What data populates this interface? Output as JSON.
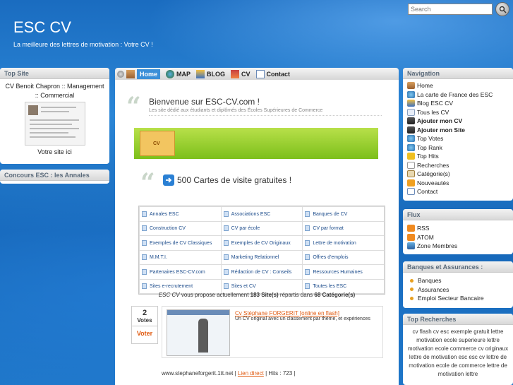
{
  "header": {
    "title": "ESC CV",
    "tagline": "La meilleure des lettres de motivation : Votre CV !",
    "search_placeholder": "Search"
  },
  "left": {
    "top_site": {
      "heading": "Top Site",
      "name": "CV Benoit Chapron :: Management :: Commercial",
      "footer": "Votre site ici"
    },
    "concours": {
      "heading": "Concours ESC : les Annales"
    }
  },
  "menu": {
    "items": [
      {
        "label": "Home",
        "icon": "home-icon"
      },
      {
        "label": "MAP",
        "icon": "globe-icon"
      },
      {
        "label": "BLOG",
        "icon": "blog-icon"
      },
      {
        "label": "CV",
        "icon": "cv-icon"
      },
      {
        "label": "Contact",
        "icon": "mail-icon"
      }
    ]
  },
  "main": {
    "welcome_title": "Bienvenue sur ESC-CV.com !",
    "welcome_sub": "Les site dédié aux étudiants et diplômés des Écoles Supérieures de Commerce",
    "banner_label": "CV",
    "cards_title": "500 Cartes de visite gratuites !",
    "grid": [
      [
        "Annales ESC",
        "Associations ESC",
        "Banques de CV"
      ],
      [
        "Construction CV",
        "CV par école",
        "CV par format"
      ],
      [
        "Exemples de CV Classiques",
        "Exemples de CV Originaux",
        "Lettre de motivation"
      ],
      [
        "M.M.T.I.",
        "Marketing Relationnel",
        "Offres d'emplois"
      ],
      [
        "Partenaires ESC-CV.com",
        "Rédaction de CV : Conseils",
        "Ressources Humaines"
      ],
      [
        "Sites e-recrutement",
        "Sites et CV",
        "Toutes les ESC"
      ]
    ],
    "stats": {
      "brand": "ESC CV",
      "text1": " vous propose actuellement ",
      "sites": "183 Site(s)",
      "text2": " répartis dans ",
      "cats": "68 Catégorie(s)"
    },
    "vote": {
      "count": "2",
      "label": "Votes",
      "button": "Voter"
    },
    "site": {
      "link": "Cv Stéphane FORGERIT [online en flash]",
      "desc": "Un CV original avec un classement par thème, et expériences",
      "url": "www.stephaneforgerit.1tt.net",
      "direct": "Lien direct",
      "hits": "| Hits : 723 |"
    }
  },
  "right": {
    "navigation": {
      "heading": "Navigation",
      "items": [
        {
          "label": "Home",
          "icon": "home-icon",
          "bold": false
        },
        {
          "label": "La carte de France des ESC",
          "icon": "globe-icon",
          "bold": false
        },
        {
          "label": "Blog ESC CV",
          "icon": "blog-icon",
          "bold": false
        },
        {
          "label": "Tous les CV",
          "icon": "list-icon",
          "bold": false
        },
        {
          "label": "Ajouter mon CV",
          "icon": "user-add-icon",
          "bold": true
        },
        {
          "label": "Ajouter mon Site",
          "icon": "user-add-icon",
          "bold": true
        },
        {
          "label": "Top Votes",
          "icon": "globe-icon",
          "bold": false
        },
        {
          "label": "Top Rank",
          "icon": "globe-icon",
          "bold": false
        },
        {
          "label": "Top Hits",
          "icon": "star-icon",
          "bold": false
        },
        {
          "label": "Recherches",
          "icon": "search-icon",
          "bold": false
        },
        {
          "label": "Catégorie(s)",
          "icon": "tree-icon",
          "bold": false
        },
        {
          "label": "Nouveautés",
          "icon": "new-icon",
          "bold": false
        },
        {
          "label": "Contact",
          "icon": "mail-icon",
          "bold": false
        }
      ]
    },
    "flux": {
      "heading": "Flux",
      "items": [
        {
          "label": "RSS",
          "icon": "rss-icon"
        },
        {
          "label": "ATOM",
          "icon": "rss-icon"
        },
        {
          "label": "Zone Membres",
          "icon": "members-icon"
        }
      ]
    },
    "banques": {
      "heading": "Banques et Assurances :",
      "items": [
        "Banques",
        "Assurances",
        "Emploi Secteur Bancaire"
      ]
    },
    "recherches": {
      "heading": "Top Recherches",
      "text": "cv flash cv esc exemple gratuit lettre motivation ecole superieure lettre motivation ecole commerce cv originaux lettre de motivation esc esc cv lettre de motivation ecole de commerce lettre de motivation lettre"
    }
  }
}
